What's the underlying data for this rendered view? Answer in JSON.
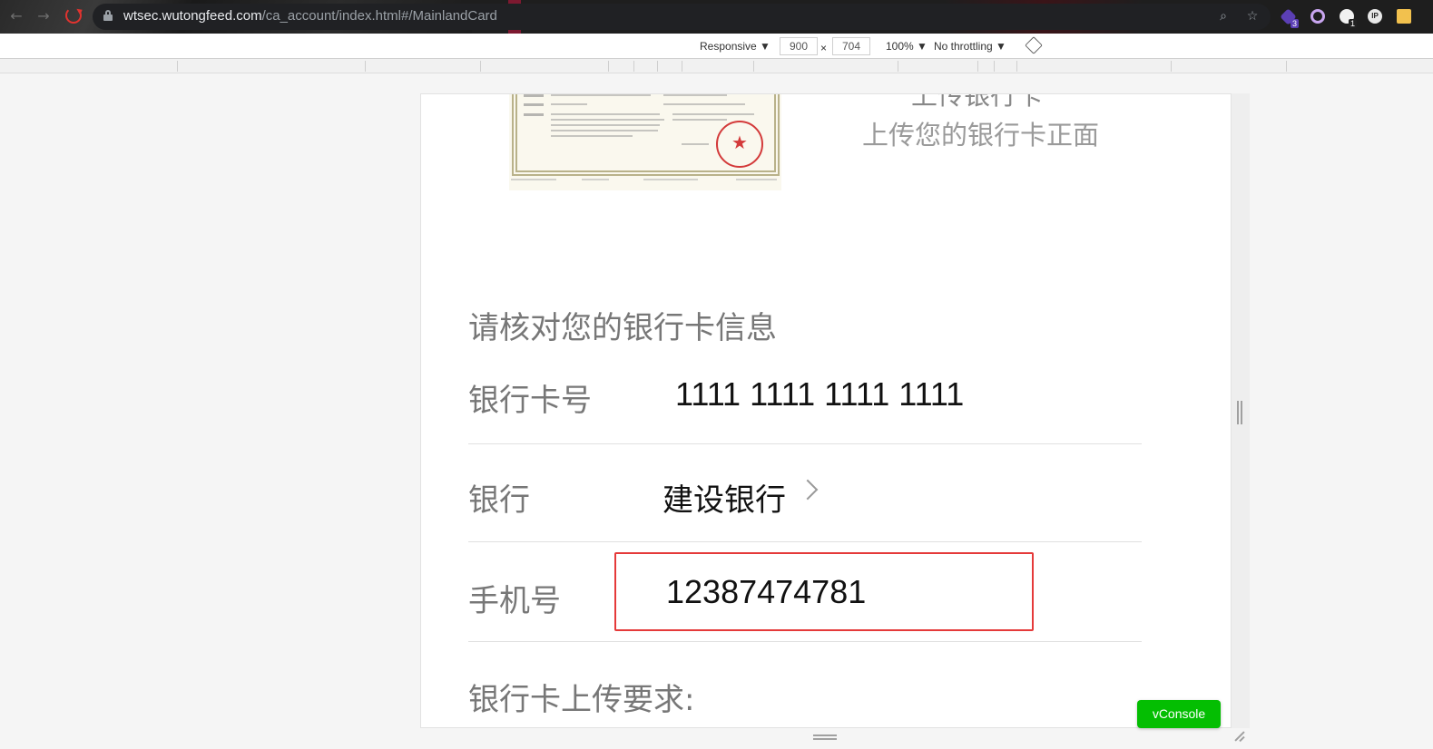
{
  "browser": {
    "url_host": "wtsec.wutongfeed.com",
    "url_path": "/ca_account/index.html#/MainlandCard",
    "ext_badge_1": "3",
    "ext_badge_2": "1",
    "ext_ip_label": "IP"
  },
  "device_toolbar": {
    "preset": "Responsive ▼",
    "width": "900",
    "separator": "×",
    "height": "704",
    "zoom": "100% ▼",
    "throttling": "No throttling ▼"
  },
  "page": {
    "upload_hint_top": "上传银行卡",
    "upload_hint": "上传您的银行卡正面",
    "section_title": "请核对您的银行卡信息",
    "card_number_label": "银行卡号",
    "card_number_value": "1111 1111 1111 1111",
    "bank_label": "银行",
    "bank_value": "建设银行",
    "phone_label": "手机号",
    "phone_value": "12387474781",
    "requirements_title": "银行卡上传要求:"
  },
  "vconsole": {
    "label": "vConsole"
  },
  "colors": {
    "highlight": "#e53a3a",
    "vconsole": "#04be02",
    "reload": "#e0332f"
  }
}
